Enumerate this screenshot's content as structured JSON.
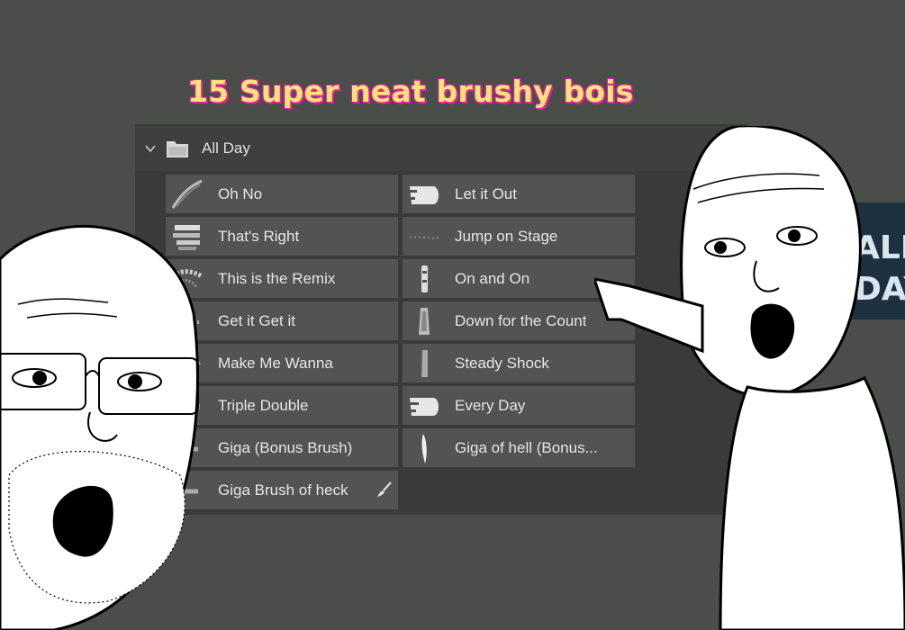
{
  "headline": "15 Super neat brushy bois",
  "group": {
    "title": "All Day",
    "icons": [
      "chevron-down-icon",
      "folder-icon"
    ]
  },
  "brushes_left": [
    {
      "label": "Oh No"
    },
    {
      "label": "That's Right"
    },
    {
      "label": "This is the Remix"
    },
    {
      "label": "Get it Get it"
    },
    {
      "label": "Make Me Wanna"
    },
    {
      "label": "Triple Double"
    },
    {
      "label": "Giga (Bonus Brush)"
    },
    {
      "label": "Giga Brush of heck"
    }
  ],
  "brushes_right": [
    {
      "label": "Let it Out"
    },
    {
      "label": "Jump on Stage"
    },
    {
      "label": "On and On"
    },
    {
      "label": "Down for the Count"
    },
    {
      "label": "Steady Shock"
    },
    {
      "label": "Every Day"
    },
    {
      "label": "Giga of hell (Bonus..."
    }
  ],
  "poster": {
    "line1": "ALL",
    "line2": "DAY"
  },
  "colors": {
    "background": "#4b4d4a",
    "panel": "#3a3a3a",
    "cell": "#535353",
    "headline": "#ffe37a",
    "headline_outline": "#e3219e"
  }
}
